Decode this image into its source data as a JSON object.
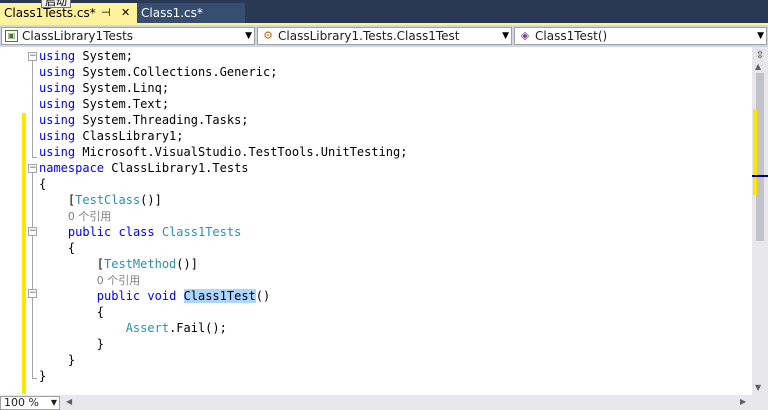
{
  "tabs": [
    {
      "label": "Class1Tests.cs*",
      "active": true
    },
    {
      "label": "Class1.cs*",
      "active": false
    }
  ],
  "tooltip": "启动",
  "navbar": {
    "project": "ClassLibrary1Tests",
    "type": "ClassLibrary1.Tests.Class1Test",
    "member": "Class1Test()"
  },
  "code": {
    "using_kw": "using",
    "usings": [
      "System;",
      "System.Collections.Generic;",
      "System.Linq;",
      "System.Text;",
      "System.Threading.Tasks;",
      "ClassLibrary1;",
      "Microsoft.VisualStudio.TestTools.UnitTesting;"
    ],
    "namespace_kw": "namespace",
    "namespace_name": "ClassLibrary1.Tests",
    "open_brace": "{",
    "close_brace": "}",
    "attr_testclass": "TestClass",
    "codelens": "0 个引用",
    "public_kw": "public",
    "class_kw": "class",
    "class_name": "Class1Tests",
    "attr_testmethod": "TestMethod",
    "void_kw": "void",
    "method_name": "Class1Test",
    "parens": "()",
    "assert_type": "Assert",
    "assert_call": ".Fail();"
  },
  "status": {
    "zoom": "100 %"
  },
  "colors": {
    "keyword": "#0000ff",
    "type": "#2b91af",
    "active_tab": "#fff29d",
    "change_bar": "#ffe600",
    "selection": "#add6ff"
  },
  "icons": [
    "pin-icon",
    "close-icon",
    "project-icon",
    "class-icon",
    "method-icon",
    "split-icon"
  ]
}
